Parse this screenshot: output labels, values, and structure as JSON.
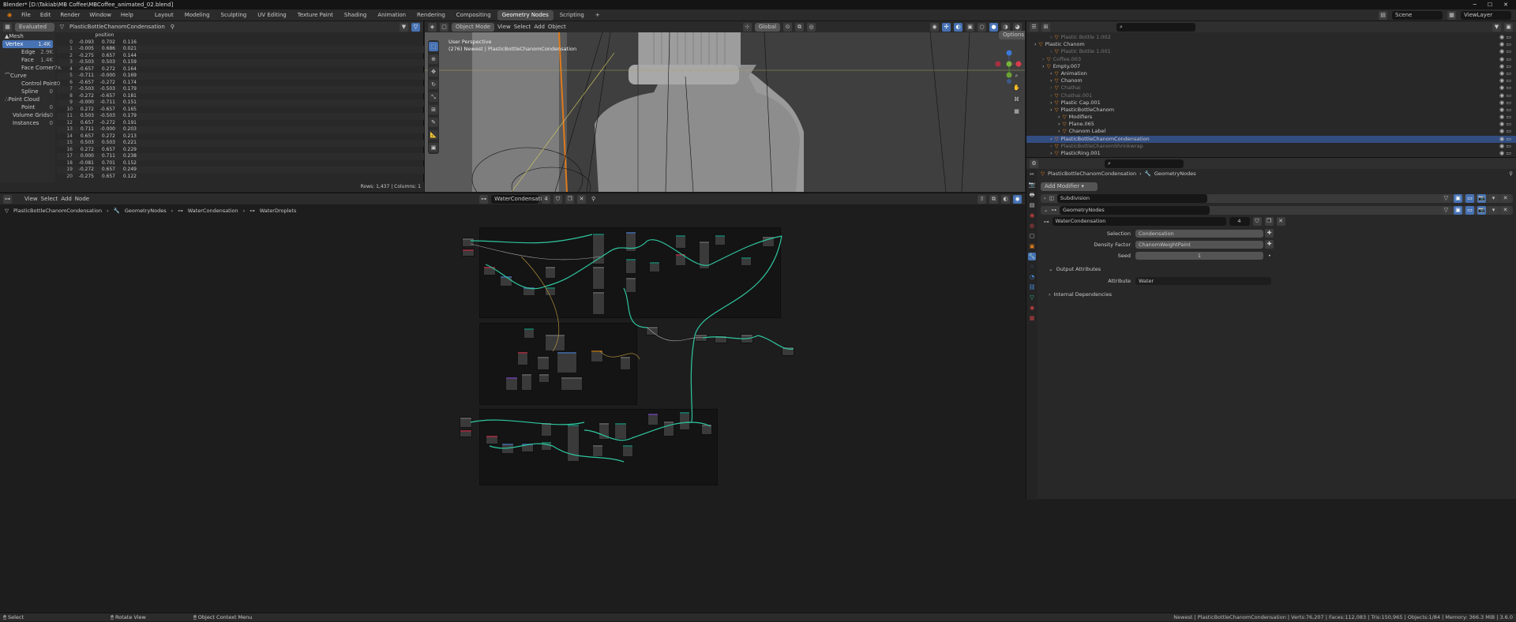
{
  "titlebar": {
    "title": "Blender* [D:\\Takiab\\MB Coffee\\MBCoffee_animated_02.blend]"
  },
  "menu": {
    "items": [
      "File",
      "Edit",
      "Render",
      "Window",
      "Help"
    ],
    "workspaces": [
      "Layout",
      "Modeling",
      "Sculpting",
      "UV Editing",
      "Texture Paint",
      "Shading",
      "Animation",
      "Rendering",
      "Compositing",
      "Geometry Nodes",
      "Scripting"
    ],
    "active_workspace": "Geometry Nodes",
    "scene": "Scene",
    "view_layer": "ViewLayer"
  },
  "spreadsheet": {
    "mode": "Evaluated",
    "object": "PlasticBottleChanomCondensation",
    "domains": [
      {
        "label": "Mesh",
        "count": ""
      },
      {
        "label": "Vertex",
        "count": "1.4K"
      },
      {
        "label": "Edge",
        "count": "2.9K"
      },
      {
        "label": "Face",
        "count": "1.4K"
      },
      {
        "label": "Face Corner",
        "count": "7K"
      },
      {
        "label": "Curve",
        "count": ""
      },
      {
        "label": "Control Point",
        "count": "0"
      },
      {
        "label": "Spline",
        "count": "0"
      },
      {
        "label": "Point Cloud",
        "count": ""
      },
      {
        "label": "Point",
        "count": "0"
      },
      {
        "label": "Volume Grids",
        "count": "0"
      },
      {
        "label": "Instances",
        "count": "0"
      }
    ],
    "column": "position",
    "rows": [
      [
        "0",
        "-0.093",
        "0.702",
        "0.116"
      ],
      [
        "1",
        "-0.005",
        "0.686",
        "0.021"
      ],
      [
        "2",
        "-0.275",
        "0.657",
        "0.144"
      ],
      [
        "3",
        "-0.503",
        "0.503",
        "0.159"
      ],
      [
        "4",
        "-0.657",
        "0.272",
        "0.164"
      ],
      [
        "5",
        "-0.711",
        "-0.000",
        "0.169"
      ],
      [
        "6",
        "-0.657",
        "-0.272",
        "0.174"
      ],
      [
        "7",
        "-0.503",
        "-0.503",
        "0.179"
      ],
      [
        "8",
        "-0.272",
        "-0.657",
        "0.181"
      ],
      [
        "9",
        "-0.000",
        "-0.711",
        "0.151"
      ],
      [
        "10",
        "0.272",
        "-0.657",
        "0.165"
      ],
      [
        "11",
        "0.503",
        "-0.503",
        "0.179"
      ],
      [
        "12",
        "0.657",
        "-0.272",
        "0.191"
      ],
      [
        "13",
        "0.711",
        "-0.000",
        "0.203"
      ],
      [
        "14",
        "0.657",
        "0.272",
        "0.213"
      ],
      [
        "15",
        "0.503",
        "0.503",
        "0.221"
      ],
      [
        "16",
        "0.272",
        "0.657",
        "0.229"
      ],
      [
        "17",
        "0.000",
        "0.711",
        "0.238"
      ],
      [
        "18",
        "-0.081",
        "0.701",
        "0.152"
      ],
      [
        "19",
        "-0.272",
        "0.657",
        "0.249"
      ],
      [
        "20",
        "-0.275",
        "0.657",
        "0.122"
      ]
    ],
    "footer_rows": "Rows: 1,437",
    "footer_cols": "Columns: 1"
  },
  "viewport": {
    "mode": "Object Mode",
    "menus": [
      "View",
      "Select",
      "Add",
      "Object"
    ],
    "orientation": "Global",
    "options": "Options",
    "info1": "User Perspective",
    "info2": "(276) Newest | PlasticBottleChanomCondensation"
  },
  "node_editor": {
    "menus": [
      "View",
      "Select",
      "Add",
      "Node"
    ],
    "tree": "WaterCondensation",
    "users": "4",
    "breadcrumb": [
      "PlasticBottleChanomCondensation",
      "GeometryNodes",
      "WaterCondensation",
      "WaterDroplets"
    ]
  },
  "outliner": {
    "rows": [
      {
        "label": "Plastic Bottle 1.002",
        "indent": 3,
        "dim": true
      },
      {
        "label": "Plastic Chanom",
        "indent": 1,
        "dim": false
      },
      {
        "label": "Plastic Bottle 1.001",
        "indent": 3,
        "dim": true
      },
      {
        "label": "Coffee.003",
        "indent": 2,
        "dim": true
      },
      {
        "label": "Empty.007",
        "indent": 2,
        "dim": false
      },
      {
        "label": "Animation",
        "indent": 3,
        "dim": false
      },
      {
        "label": "Chanom",
        "indent": 3,
        "dim": false
      },
      {
        "label": "Chathai",
        "indent": 3,
        "dim": true
      },
      {
        "label": "Chathai.001",
        "indent": 3,
        "dim": true
      },
      {
        "label": "Plastic Cap.001",
        "indent": 3,
        "dim": false
      },
      {
        "label": "PlasticBottleChanom",
        "indent": 3,
        "dim": false
      },
      {
        "label": "Modifiers",
        "indent": 4,
        "dim": false
      },
      {
        "label": "Plane.065",
        "indent": 4,
        "dim": false
      },
      {
        "label": "Chanom Label",
        "indent": 4,
        "dim": false
      },
      {
        "label": "PlasticBottleChanomCondensation",
        "indent": 3,
        "dim": false,
        "selected": true
      },
      {
        "label": "PlasticBottleChanomShrinkwrap",
        "indent": 3,
        "dim": true
      },
      {
        "label": "PlasticRing.001",
        "indent": 3,
        "dim": false
      }
    ]
  },
  "properties": {
    "object": "PlasticBottleChanomCondensation",
    "modifier": "GeometryNodes",
    "add_modifier": "Add Modifier",
    "modifiers": [
      "Subdivision",
      "GeometryNodes"
    ],
    "node_group": "WaterCondensation",
    "users": "4",
    "fields": [
      {
        "label": "Selection",
        "value": "Condensation"
      },
      {
        "label": "Density Factor",
        "value": "ChanomWeightPaint"
      },
      {
        "label": "Seed",
        "value": "1"
      }
    ],
    "output_attributes": "Output Attributes",
    "attribute_label": "Attribute",
    "attribute_value": "Water",
    "internal": "Internal Dependencies"
  },
  "statusbar": {
    "select": "Select",
    "rotate": "Rotate View",
    "context": "Object Context Menu",
    "stats": "Newest | PlasticBottleChanomCondensation | Verts:76,207 | Faces:112,083 | Tris:150,965 | Objects:1/84 | Memory: 366.3 MiB | 3.6.0"
  },
  "colors": {
    "accent": "#4772b3",
    "link": "#2fc7a0",
    "selected_row": "#334d80"
  }
}
